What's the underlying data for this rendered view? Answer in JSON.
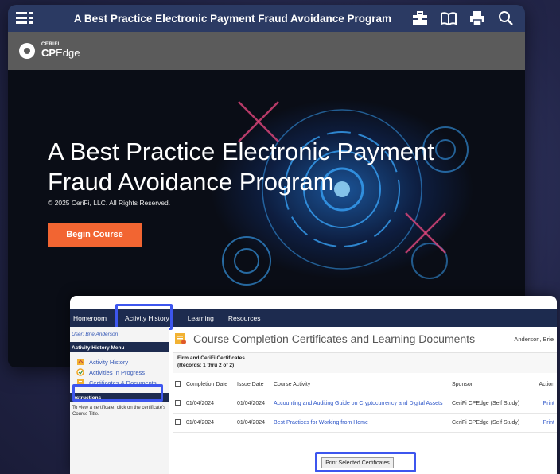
{
  "player": {
    "course_title": "A Best Practice Electronic Payment Fraud Avoidance Program",
    "icons": [
      "menu-icon",
      "toolbox-icon",
      "book-icon",
      "print-icon",
      "search-icon"
    ],
    "brand": {
      "small": "CERIFI",
      "main": "CP",
      "edge": "Edge"
    },
    "hero": {
      "title": "A Best Practice Electronic Payment Fraud Avoidance Program",
      "copyright": "© 2025 CeriFi, LLC. All Rights Reserved.",
      "begin_label": "Begin Course"
    },
    "colors": {
      "topbar": "#2b3a63",
      "brandbar": "#5b5b5b",
      "accent": "#f26532"
    }
  },
  "lms": {
    "nav": [
      "Homeroom",
      "Activity History",
      "Learning",
      "Resources"
    ],
    "user_line": "User: Brie Anderson",
    "menu_head": "Activity History Menu",
    "menu": [
      "Activity History",
      "Activities In Progress",
      "Certificates & Documents"
    ],
    "instructions_head": "Instructions",
    "instructions_text": "To view a certificate, click on the certificate's Course Title.",
    "page_title": "Course Completion Certificates and Learning Documents",
    "user_name": "Anderson, Brie",
    "section_title": "Firm and CeriFi Certificates",
    "records": "(Records: 1 thru 2 of 2)",
    "columns": [
      "Completion Date",
      "Issue Date",
      "Course Activity",
      "Sponsor",
      "Action"
    ],
    "rows": [
      {
        "completion": "01/04/2024",
        "issue": "01/04/2024",
        "activity": "Accounting and Auditing Guide on Cryptocurrency and Digital Assets",
        "sponsor": "CeriFi CPEdge (Self Study)",
        "action": "Print"
      },
      {
        "completion": "01/04/2024",
        "issue": "01/04/2024",
        "activity": "Best Practices for Working from Home",
        "sponsor": "CeriFi CPEdge (Self Study)",
        "action": "Print"
      }
    ],
    "print_selected": "Print Selected Certificates",
    "highlight_color": "#3d56ee"
  }
}
